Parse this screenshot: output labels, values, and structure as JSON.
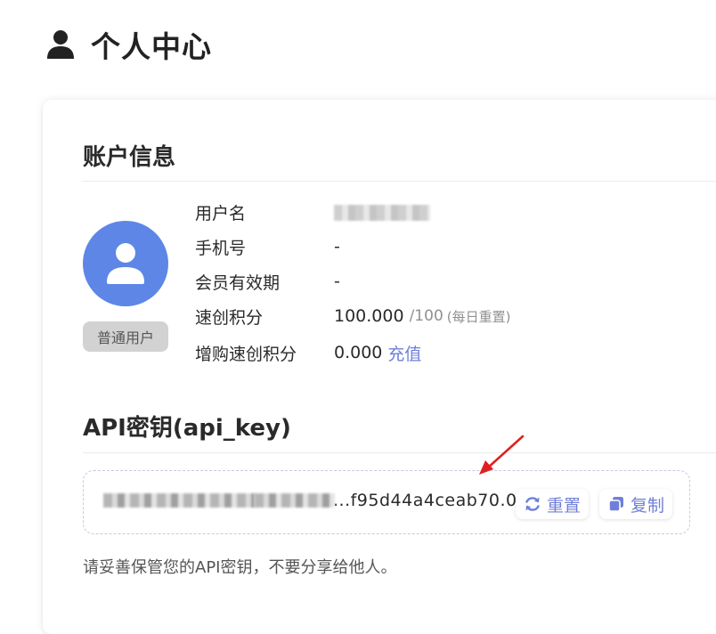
{
  "page": {
    "title": "个人中心",
    "icon": "user-icon"
  },
  "account": {
    "section_title": "账户信息",
    "avatar_icon": "user-avatar-icon",
    "badge": "普通用户",
    "rows": [
      {
        "label": "用户名",
        "value": ""
      },
      {
        "label": "手机号",
        "value": "-"
      },
      {
        "label": "会员有效期",
        "value": "-"
      },
      {
        "label": "速创积分",
        "value": "100.000",
        "limit": "/100",
        "note": "(每日重置)"
      },
      {
        "label": "增购速创积分",
        "value": "0.000",
        "link": "充值"
      }
    ]
  },
  "api": {
    "section_title": "API密钥(api_key)",
    "key_visible_tail": "...f95d44a4ceab70.0.3e",
    "reset_label": "重置",
    "reset_icon": "refresh-icon",
    "copy_label": "复制",
    "copy_icon": "copy-icon",
    "hint": "请妥善保管您的API密钥，不要分享给他人。"
  },
  "colors": {
    "accent": "#6f7fd8",
    "avatar_bg": "#5d86e6",
    "badge_bg": "#d2d2d2",
    "annotation_arrow": "#e02020"
  }
}
